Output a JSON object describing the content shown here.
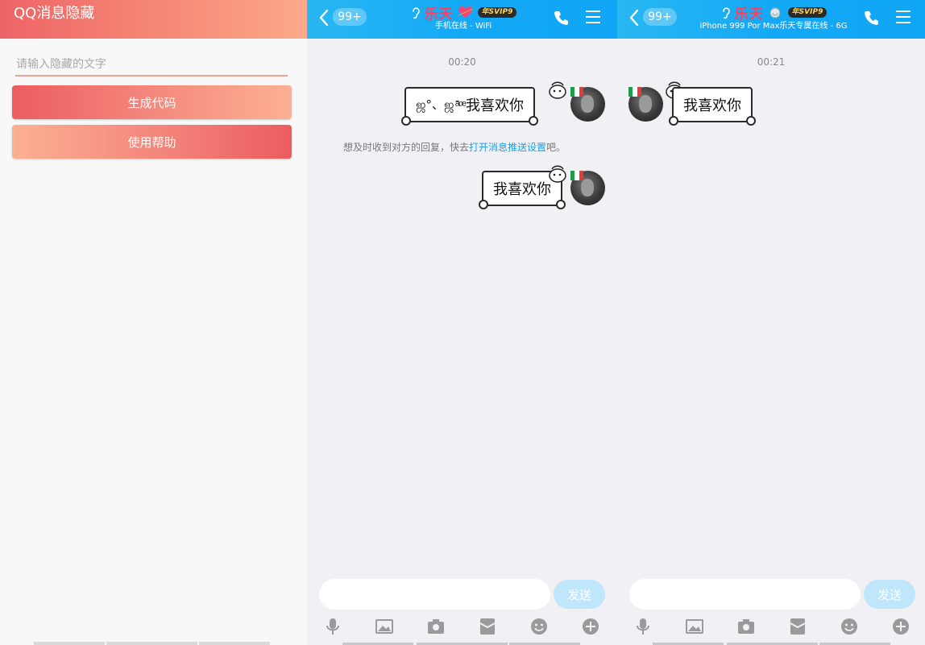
{
  "app": {
    "title": "QQ消息隐藏",
    "input_placeholder": "请输入隐藏的文字",
    "buttons": {
      "generate": "生成代码",
      "help": "使用帮助"
    }
  },
  "chat_common": {
    "badge": "99+",
    "contact_name": "乐天",
    "svip_label": "年SVIP9",
    "send_label": "发送",
    "message_text": "我喜欢你",
    "toolbar_icons": [
      "microphone-icon",
      "image-icon",
      "camera-icon",
      "red-packet-icon",
      "emoji-icon",
      "plus-icon"
    ]
  },
  "chat_sender": {
    "status": "手机在线 - WiFi",
    "time": "00:20",
    "messages": [
      {
        "prefix": "ஜ°、ஜ ̄ͣ ͦ ͤ",
        "text": "我喜欢你"
      },
      {
        "text": "我喜欢你"
      }
    ],
    "notice": {
      "before": "想及时收到对方的回复，快去",
      "link": "打开消息推送设置",
      "after": "吧。"
    }
  },
  "chat_receiver": {
    "status": "iPhone 999 Por Max乐天专属在线 - 6G",
    "time": "00:21",
    "messages": [
      {
        "text": "我喜欢你"
      }
    ]
  },
  "colors": {
    "app_gradient_start": "#ee6466",
    "app_gradient_end": "#fba98a",
    "qq_header": "#14a9f6",
    "send_button": "#bfe6fb",
    "link": "#1aa0e6"
  }
}
